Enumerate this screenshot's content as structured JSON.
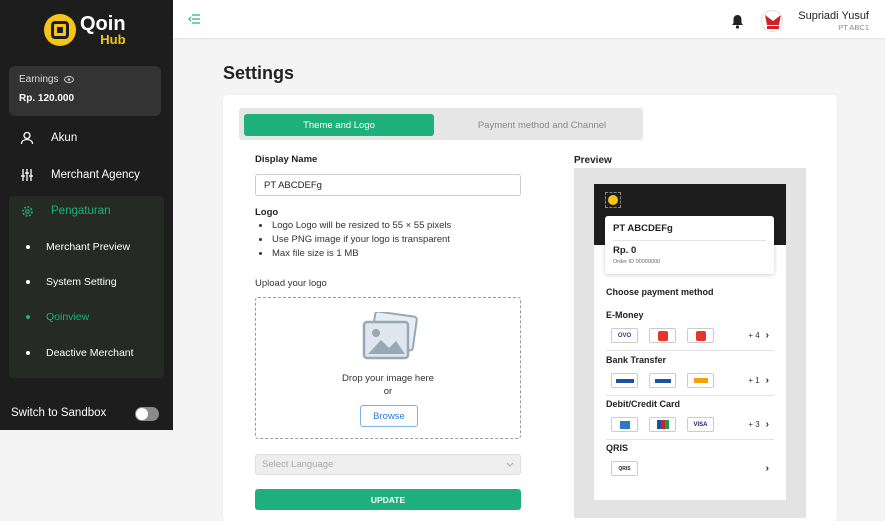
{
  "app": {
    "brand": "Qoin",
    "brand_sub": "Hub"
  },
  "sidebar": {
    "earnings_label": "Earnings",
    "earnings_value": "Rp. 120.000",
    "items": [
      {
        "label": "Akun",
        "icon": "user-icon"
      },
      {
        "label": "Merchant Agency",
        "icon": "sliders-icon"
      },
      {
        "label": "Pengaturan",
        "icon": "gear-icon"
      }
    ],
    "sub_items": [
      {
        "label": "Merchant Preview",
        "active": false
      },
      {
        "label": "System Setting",
        "active": false
      },
      {
        "label": "Qoinview",
        "active": true
      },
      {
        "label": "Deactive Merchant",
        "active": false
      }
    ],
    "sandbox_label": "Switch to Sandbox",
    "sandbox_on": false
  },
  "header": {
    "user_name": "Supriadi Yusuf",
    "user_company": "PT ABC1"
  },
  "page": {
    "title": "Settings"
  },
  "tabs": [
    {
      "label": "Theme and Logo",
      "active": true
    },
    {
      "label": "Payment method and Channel",
      "active": false
    }
  ],
  "form": {
    "display_name_label": "Display Name",
    "display_name_value": "PT ABCDEFg",
    "logo_label": "Logo",
    "logo_notes": [
      "Logo Logo will be resized to 55 × 55 pixels",
      "Use PNG image if your logo is transparent",
      "Max file size is 1 MB"
    ],
    "upload_label": "Upload your logo",
    "drop_text": "Drop your image here",
    "or_text": "or",
    "browse_label": "Browse",
    "language_placeholder": "Select Language",
    "update_label": "UPDATE"
  },
  "preview": {
    "label": "Preview",
    "merchant_name": "PT ABCDEFg",
    "amount": "Rp. 0",
    "order_id": "Order ID 00000000",
    "choose_label": "Choose payment method",
    "sections": [
      {
        "title": "E-Money",
        "logos": [
          "OVO",
          "",
          ""
        ],
        "more": "+ 4"
      },
      {
        "title": "Bank Transfer",
        "logos": [
          "",
          "",
          ""
        ],
        "more": "+ 1"
      },
      {
        "title": "Debit/Credit Card",
        "logos": [
          "",
          "",
          "VISA"
        ],
        "more": "+ 3"
      },
      {
        "title": "QRIS",
        "logos": [
          "QRIS"
        ],
        "more": ""
      }
    ]
  },
  "colors": {
    "accent": "#20b07d",
    "sidebar_bg": "#1d1d1d",
    "brand_yellow": "#f5c518"
  }
}
